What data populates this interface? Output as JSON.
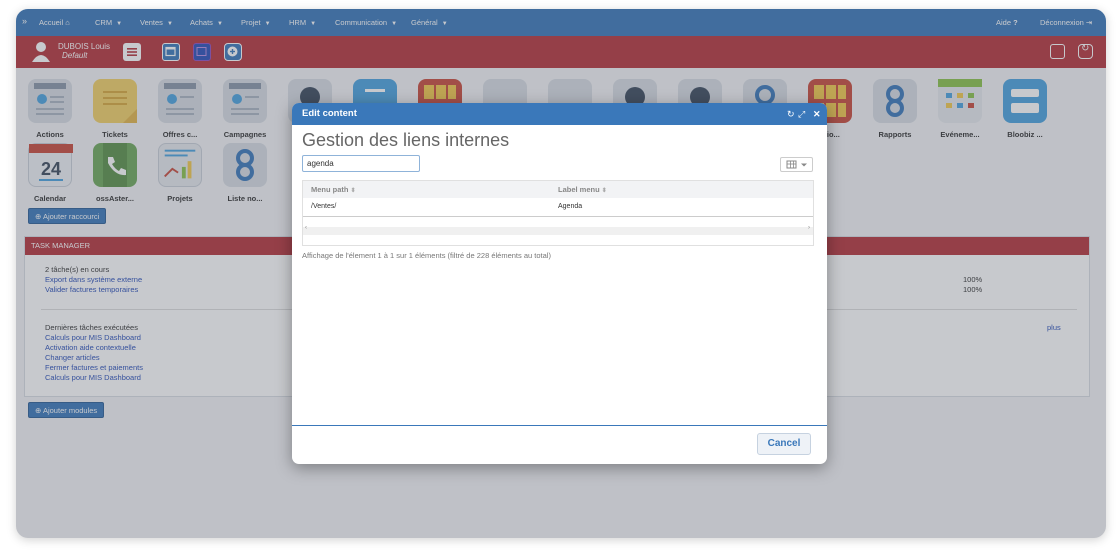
{
  "topnav": {
    "items": [
      "Accueil",
      "CRM",
      "Ventes",
      "Achats",
      "Projet",
      "HRM",
      "Communication",
      "Général"
    ],
    "help": "Aide",
    "logout": "Déconnexion"
  },
  "user": {
    "name": "DUBOIS Louis",
    "role": "Default"
  },
  "tiles": {
    "row1": [
      "Actions",
      "Tickets",
      "Offres c...",
      "Campagnes",
      "atio...",
      "Rapports",
      "Evéneme...",
      "Bloobiz ..."
    ],
    "row2": [
      "Calendar",
      "ossAster...",
      "Projets",
      "Liste no..."
    ],
    "calendar_day": "24",
    "add_shortcut": "Ajouter raccourci"
  },
  "task_manager": {
    "title": "TASK MANAGER",
    "running": "2 tâche(s) en cours",
    "running_tasks": [
      "Export dans système externe",
      "Valider factures temporaires"
    ],
    "progress": [
      "100%",
      "100%"
    ],
    "last_title": "Dernières tâches exécutées",
    "last_tasks": [
      "Calculs pour MIS Dashboard",
      "Activation aide contextuelle",
      "Changer articles",
      "Fermer factures et paiements",
      "Calculs pour MIS Dashboard"
    ],
    "more": "plus",
    "add_modules": "Ajouter modules"
  },
  "modal": {
    "header": "Edit content",
    "title": "Gestion des liens internes",
    "search_value": "agenda",
    "columns": [
      "Menu path",
      "Label menu"
    ],
    "rows": [
      {
        "path": "/Ventes/",
        "label": "Agenda"
      }
    ],
    "info": "Affichage de l'élement 1 à 1 sur 1 éléments (filtré de 228 éléments au total)",
    "cancel": "Cancel"
  },
  "colors": {
    "nav_blue": "#3a78ba",
    "bar_red": "#b6343c"
  }
}
